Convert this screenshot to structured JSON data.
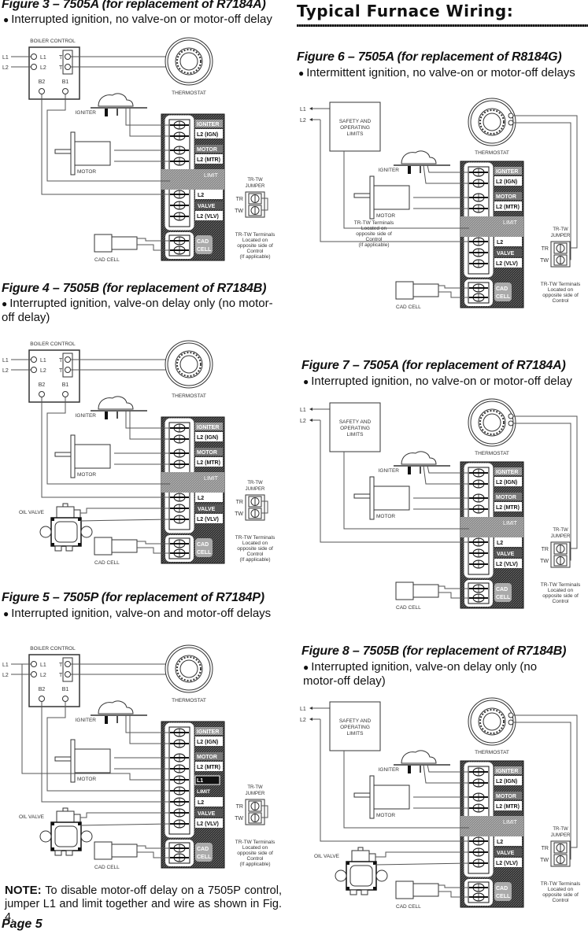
{
  "section_title": "Typical Furnace Wiring:",
  "note": {
    "label": "NOTE:",
    "text": " To disable motor-off delay on a 7505P control, jumper L1 and limit together and wire as shown in Fig. 4."
  },
  "page_label": "Page 5",
  "labels": {
    "boiler_control": "BOILER CONTROL",
    "thermostat": "THERMOSTAT",
    "igniter": "IGNITER",
    "motor": "MOTOR",
    "cad_cell": "CAD CELL",
    "oil_valve": "OIL VALVE",
    "safety_limits": [
      "SAFETY AND",
      "OPERATING",
      "LIMITS"
    ],
    "line_l1": "L1",
    "line_l2": "L2",
    "term_t": "T",
    "term_b1": "B1",
    "term_b2": "B2",
    "jumper_title": [
      "TR-TW",
      "JUMPER"
    ],
    "jumper_tr": "TR",
    "jumper_tw": "TW",
    "terminals_note": [
      "TR-TW Terminals",
      "Located on",
      "opposite side of",
      "Control",
      "(If applicable)"
    ],
    "control_igniter": "IGNITER",
    "control_l2_ign": "L2 (IGN)",
    "control_motor": "MOTOR",
    "control_l2_mtr": "L2 (MTR)",
    "control_limit": "LIMIT",
    "control_l1": "L1",
    "control_l2": "L2",
    "control_valve": "VALVE",
    "control_l2_vlv": "L2 (VLV)",
    "control_cad": "CAD",
    "control_cell": "CELL"
  },
  "figures": [
    {
      "id": "fig3",
      "title": "Figure 3 – 7505A (for replacement of R7184A)",
      "description": "Interrupted ignition, no valve-on or motor-off delay",
      "source": "boiler",
      "oil_valve": false,
      "separate_l1": false,
      "show_if_applicable": true
    },
    {
      "id": "fig4",
      "title": "Figure 4 – 7505B (for replacement of R7184B)",
      "description": "Interrupted ignition, valve-on delay only (no motor-off delay)",
      "source": "boiler",
      "oil_valve": true,
      "separate_l1": false,
      "show_if_applicable": true
    },
    {
      "id": "fig5",
      "title": "Figure 5 – 7505P (for replacement of R7184P)",
      "description": "Interrupted ignition, valve-on and motor-off delays",
      "source": "boiler",
      "oil_valve": true,
      "separate_l1": true,
      "show_if_applicable": true
    },
    {
      "id": "fig6",
      "title": "Figure 6 – 7505A (for replacement of R8184G)",
      "description": "Intermittent ignition, no valve-on or motor-off delays",
      "source": "furnace",
      "oil_valve": false,
      "separate_l1": false,
      "show_if_applicable": false,
      "overlapping_note": [
        "TR-TW Terminals",
        "Located on",
        "opposite side of",
        "Control",
        "(If applicable)"
      ]
    },
    {
      "id": "fig7",
      "title": "Figure 7 – 7505A (for replacement of R7184A)",
      "description": "Interrupted ignition, no valve-on or motor-off delay",
      "source": "furnace",
      "oil_valve": false,
      "separate_l1": false,
      "show_if_applicable": false
    },
    {
      "id": "fig8",
      "title": "Figure 8 – 7505B (for replacement of R7184B)",
      "description": "Interrupted ignition, valve-on delay only (no motor-off delay)",
      "source": "furnace",
      "oil_valve": true,
      "separate_l1": false,
      "show_if_applicable": false
    }
  ]
}
